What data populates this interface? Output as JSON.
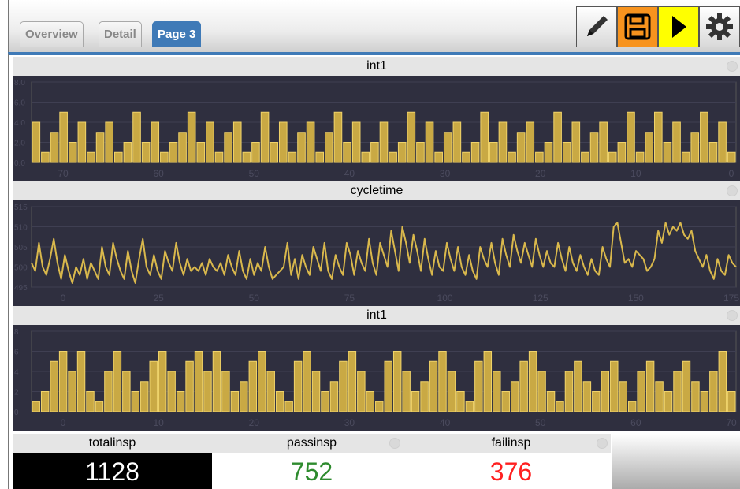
{
  "tabs": [
    {
      "label": "Overview"
    },
    {
      "label": "Detail"
    },
    {
      "label": "Page 3"
    }
  ],
  "toolbar": {
    "edit_icon": "pencil-icon",
    "save_icon": "floppy-icon",
    "run_icon": "play-icon",
    "settings_icon": "gear-icon"
  },
  "colors": {
    "accent": "#3f7ab7",
    "chart_bg": "#2f2f3f",
    "series": "#d9b84c",
    "pass": "#2e8b2e",
    "fail": "#ff2020"
  },
  "chart_data": [
    {
      "type": "bar",
      "title": "int1",
      "ylim": [
        0,
        8
      ],
      "yticks": [
        "8.0",
        "6.0",
        "4.0",
        "2.0",
        "0.0"
      ],
      "xticks": [
        "70",
        "60",
        "50",
        "40",
        "30",
        "20",
        "10",
        "0"
      ],
      "x_reversed": true,
      "values": [
        4,
        1,
        3,
        5,
        2,
        4,
        1,
        3,
        4,
        1,
        2,
        5,
        2,
        4,
        1,
        2,
        3,
        5,
        2,
        4,
        1,
        3,
        4,
        1,
        2,
        5,
        2,
        4,
        1,
        3,
        4,
        1,
        3,
        5,
        2,
        4,
        1,
        2,
        4,
        1,
        2,
        5,
        2,
        4,
        1,
        3,
        4,
        1,
        2,
        5,
        2,
        4,
        1,
        3,
        4,
        1,
        2,
        5,
        2,
        4,
        1,
        3,
        4,
        1,
        2,
        5,
        1,
        3,
        5,
        2,
        4,
        1,
        3,
        5,
        2,
        4,
        1
      ]
    },
    {
      "type": "line",
      "title": "cycletime",
      "ylim": [
        495,
        515
      ],
      "yticks": [
        "515",
        "510",
        "505",
        "500",
        "495"
      ],
      "xticks": [
        "0",
        "25",
        "50",
        "75",
        "100",
        "125",
        "150",
        "175"
      ],
      "values": [
        501,
        499,
        506,
        500,
        498,
        502,
        507,
        501,
        497,
        503,
        499,
        496,
        500,
        498,
        502,
        497,
        501,
        499,
        497,
        505,
        500,
        498,
        506,
        502,
        499,
        497,
        504,
        499,
        496,
        502,
        507,
        500,
        498,
        503,
        499,
        497,
        504,
        501,
        499,
        506,
        501,
        498,
        502,
        499,
        500,
        499,
        501,
        498,
        502,
        500,
        499,
        501,
        498,
        503,
        500,
        498,
        504,
        499,
        497,
        502,
        498,
        501,
        499,
        505,
        500,
        497,
        498,
        499,
        500,
        506,
        498,
        502,
        497,
        503,
        500,
        498,
        505,
        502,
        499,
        506,
        499,
        497,
        503,
        500,
        498,
        506,
        503,
        498,
        504,
        501,
        499,
        507,
        501,
        498,
        506,
        503,
        500,
        509,
        504,
        499,
        510,
        506,
        501,
        508,
        504,
        499,
        507,
        502,
        498,
        504,
        500,
        499,
        506,
        502,
        499,
        505,
        500,
        498,
        503,
        499,
        497,
        505,
        502,
        500,
        506,
        501,
        498,
        507,
        503,
        500,
        508,
        504,
        501,
        506,
        503,
        500,
        507,
        503,
        500,
        504,
        501,
        500,
        506,
        502,
        499,
        505,
        501,
        499,
        503,
        500,
        498,
        502,
        499,
        498,
        505,
        502,
        500,
        510,
        511,
        506,
        501,
        502,
        500,
        504,
        503,
        502,
        499,
        500,
        502,
        509,
        506,
        511,
        508,
        510,
        509,
        511,
        508,
        507,
        509,
        504,
        502,
        500,
        503,
        499,
        497,
        502,
        499,
        498,
        503,
        501,
        500
      ]
    },
    {
      "type": "bar",
      "title": "int1",
      "ylim": [
        0,
        8
      ],
      "yticks": [
        "8",
        "6",
        "4",
        "2",
        "0"
      ],
      "xticks": [
        "0",
        "10",
        "20",
        "30",
        "40",
        "50",
        "60",
        "70"
      ],
      "values": [
        1,
        2,
        5,
        6,
        4,
        6,
        2,
        1,
        4,
        6,
        4,
        2,
        3,
        5,
        6,
        4,
        2,
        5,
        6,
        4,
        6,
        4,
        2,
        3,
        5,
        6,
        4,
        2,
        1,
        5,
        6,
        4,
        2,
        3,
        5,
        6,
        4,
        2,
        1,
        5,
        6,
        4,
        2,
        3,
        5,
        6,
        4,
        2,
        1,
        5,
        6,
        4,
        2,
        3,
        5,
        6,
        4,
        2,
        1,
        4,
        5,
        3,
        2,
        4,
        5,
        3,
        1,
        4,
        5,
        3,
        2,
        4,
        5,
        3,
        2,
        4,
        6,
        2
      ]
    }
  ],
  "stats": [
    {
      "label": "totalinsp",
      "value": "1128"
    },
    {
      "label": "passinsp",
      "value": "752"
    },
    {
      "label": "failinsp",
      "value": "376"
    }
  ]
}
